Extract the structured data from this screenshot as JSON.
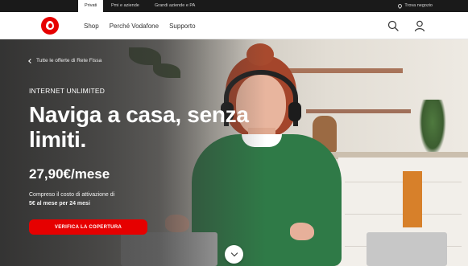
{
  "topbar": {
    "segments": [
      "Privati",
      "Pmi e aziende",
      "Grandi aziende e PA"
    ],
    "store_label": "Trova negozio"
  },
  "nav": {
    "links": [
      "Shop",
      "Perché Vodafone",
      "Supporto"
    ],
    "brand_color": "#e60000"
  },
  "hero": {
    "back_link": "Tutte le offerte di Rete Fissa",
    "eyebrow": "INTERNET UNLIMITED",
    "headline": "Naviga a casa, senza limiti.",
    "price": "27,90€/mese",
    "note_prefix": "Compreso il costo di attivazione di",
    "note_bold": "5€ al mese per 24 mesi",
    "cta_label": "VERIFICA LA COPERTURA",
    "cta_color": "#e60000"
  },
  "icons": {
    "search": "search-icon",
    "user": "user-icon",
    "scroll": "chevron-down-icon",
    "back": "chevron-left-icon",
    "logo": "vodafone-logo",
    "store": "location-pin-icon"
  }
}
